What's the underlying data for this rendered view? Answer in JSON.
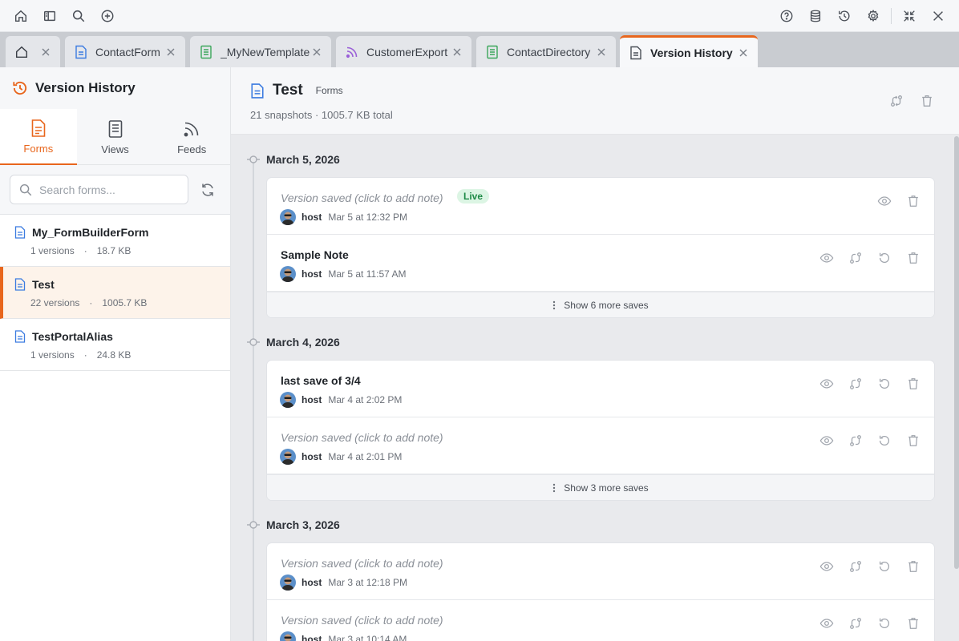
{
  "toolbar": {
    "icons": [
      "home-icon",
      "sidebar-icon",
      "search-icon",
      "add-icon",
      "help-icon",
      "database-icon",
      "history-icon",
      "gear-icon",
      "collapse-icon",
      "close-icon"
    ]
  },
  "tabs": [
    {
      "label": "",
      "icon": "home-icon"
    },
    {
      "label": "ContactForm",
      "icon": "form-icon"
    },
    {
      "label": "_MyNewTemplate",
      "icon": "view-icon"
    },
    {
      "label": "CustomerExport",
      "icon": "feed-icon"
    },
    {
      "label": "ContactDirectory",
      "icon": "view-icon"
    },
    {
      "label": "Version History",
      "icon": "document-icon",
      "active": true
    }
  ],
  "sidebar": {
    "title": "Version History",
    "tabs": [
      {
        "label": "Forms",
        "active": true
      },
      {
        "label": "Views"
      },
      {
        "label": "Feeds"
      }
    ],
    "search_placeholder": "Search forms...",
    "forms": [
      {
        "name": "My_FormBuilderForm",
        "versions": "1 versions",
        "size": "18.7 KB"
      },
      {
        "name": "Test",
        "versions": "22 versions",
        "size": "1005.7 KB",
        "selected": true
      },
      {
        "name": "TestPortalAlias",
        "versions": "1 versions",
        "size": "24.8 KB"
      }
    ]
  },
  "main": {
    "title": "Test",
    "type": "Forms",
    "summary": "21 snapshots · 1005.7 KB total",
    "groups": [
      {
        "date": "March 5, 2026",
        "entries": [
          {
            "note": "Version saved  (click to add note)",
            "placeholder": true,
            "live": "Live",
            "user": "host",
            "time": "Mar 5 at 12:32 PM"
          },
          {
            "note": "Sample Note",
            "placeholder": false,
            "user": "host",
            "time": "Mar 5 at 11:57 AM"
          }
        ],
        "more": "Show 6 more saves"
      },
      {
        "date": "March 4, 2026",
        "entries": [
          {
            "note": "last save of 3/4",
            "placeholder": false,
            "user": "host",
            "time": "Mar 4 at 2:02 PM"
          },
          {
            "note": "Version saved  (click to add note)",
            "placeholder": true,
            "user": "host",
            "time": "Mar 4 at 2:01 PM"
          }
        ],
        "more": "Show 3 more saves"
      },
      {
        "date": "March 3, 2026",
        "entries": [
          {
            "note": "Version saved  (click to add note)",
            "placeholder": true,
            "user": "host",
            "time": "Mar 3 at 12:18 PM"
          },
          {
            "note": "Version saved  (click to add note)",
            "placeholder": true,
            "user": "host",
            "time": "Mar 3 at 10:14 AM"
          }
        ]
      }
    ]
  },
  "colors": {
    "accent": "#e8661d",
    "live_bg": "#dcf5e4",
    "live_text": "#1f8a47"
  }
}
